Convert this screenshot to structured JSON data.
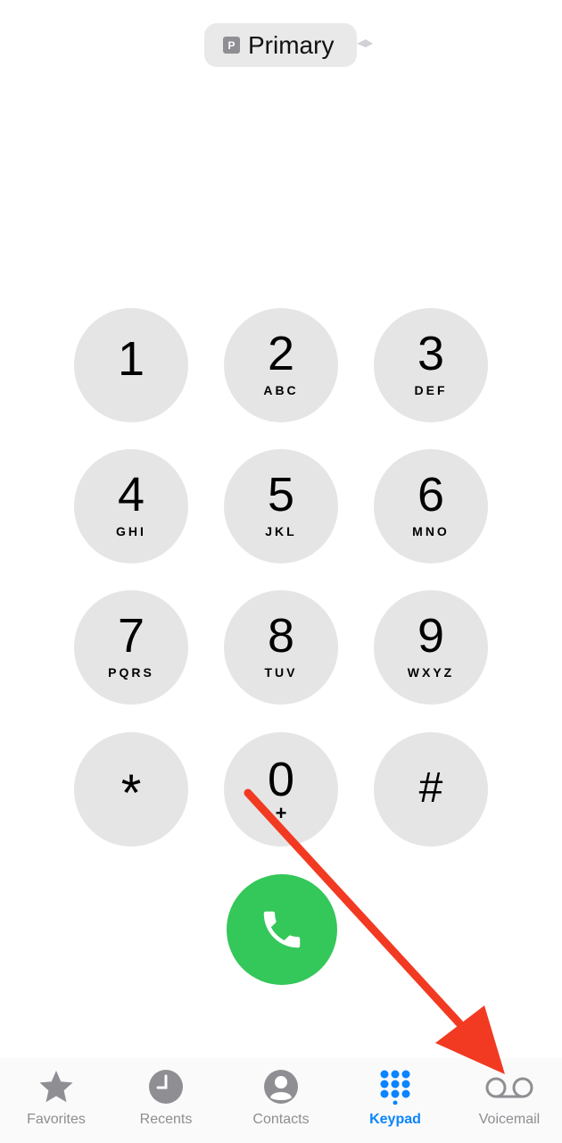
{
  "line_selector": {
    "badge": "P",
    "label": "Primary"
  },
  "keypad": {
    "keys": [
      {
        "digit": "1",
        "letters": ""
      },
      {
        "digit": "2",
        "letters": "ABC"
      },
      {
        "digit": "3",
        "letters": "DEF"
      },
      {
        "digit": "4",
        "letters": "GHI"
      },
      {
        "digit": "5",
        "letters": "JKL"
      },
      {
        "digit": "6",
        "letters": "MNO"
      },
      {
        "digit": "7",
        "letters": "PQRS"
      },
      {
        "digit": "8",
        "letters": "TUV"
      },
      {
        "digit": "9",
        "letters": "WXYZ"
      },
      {
        "digit": "*",
        "letters": ""
      },
      {
        "digit": "0",
        "letters": "+"
      },
      {
        "digit": "#",
        "letters": ""
      }
    ]
  },
  "call_button": {
    "icon": "phone-icon",
    "color": "#34c759"
  },
  "tabbar": {
    "tabs": [
      {
        "label": "Favorites",
        "icon": "star-icon",
        "active": false
      },
      {
        "label": "Recents",
        "icon": "clock-icon",
        "active": false
      },
      {
        "label": "Contacts",
        "icon": "person-icon",
        "active": false
      },
      {
        "label": "Keypad",
        "icon": "keypad-icon",
        "active": true
      },
      {
        "label": "Voicemail",
        "icon": "voicemail-icon",
        "active": false
      }
    ]
  },
  "colors": {
    "accent": "#0a84ff",
    "key_bg": "#e5e5e5",
    "inactive_tab": "#8e8e93",
    "arrow": "#f23a22"
  }
}
